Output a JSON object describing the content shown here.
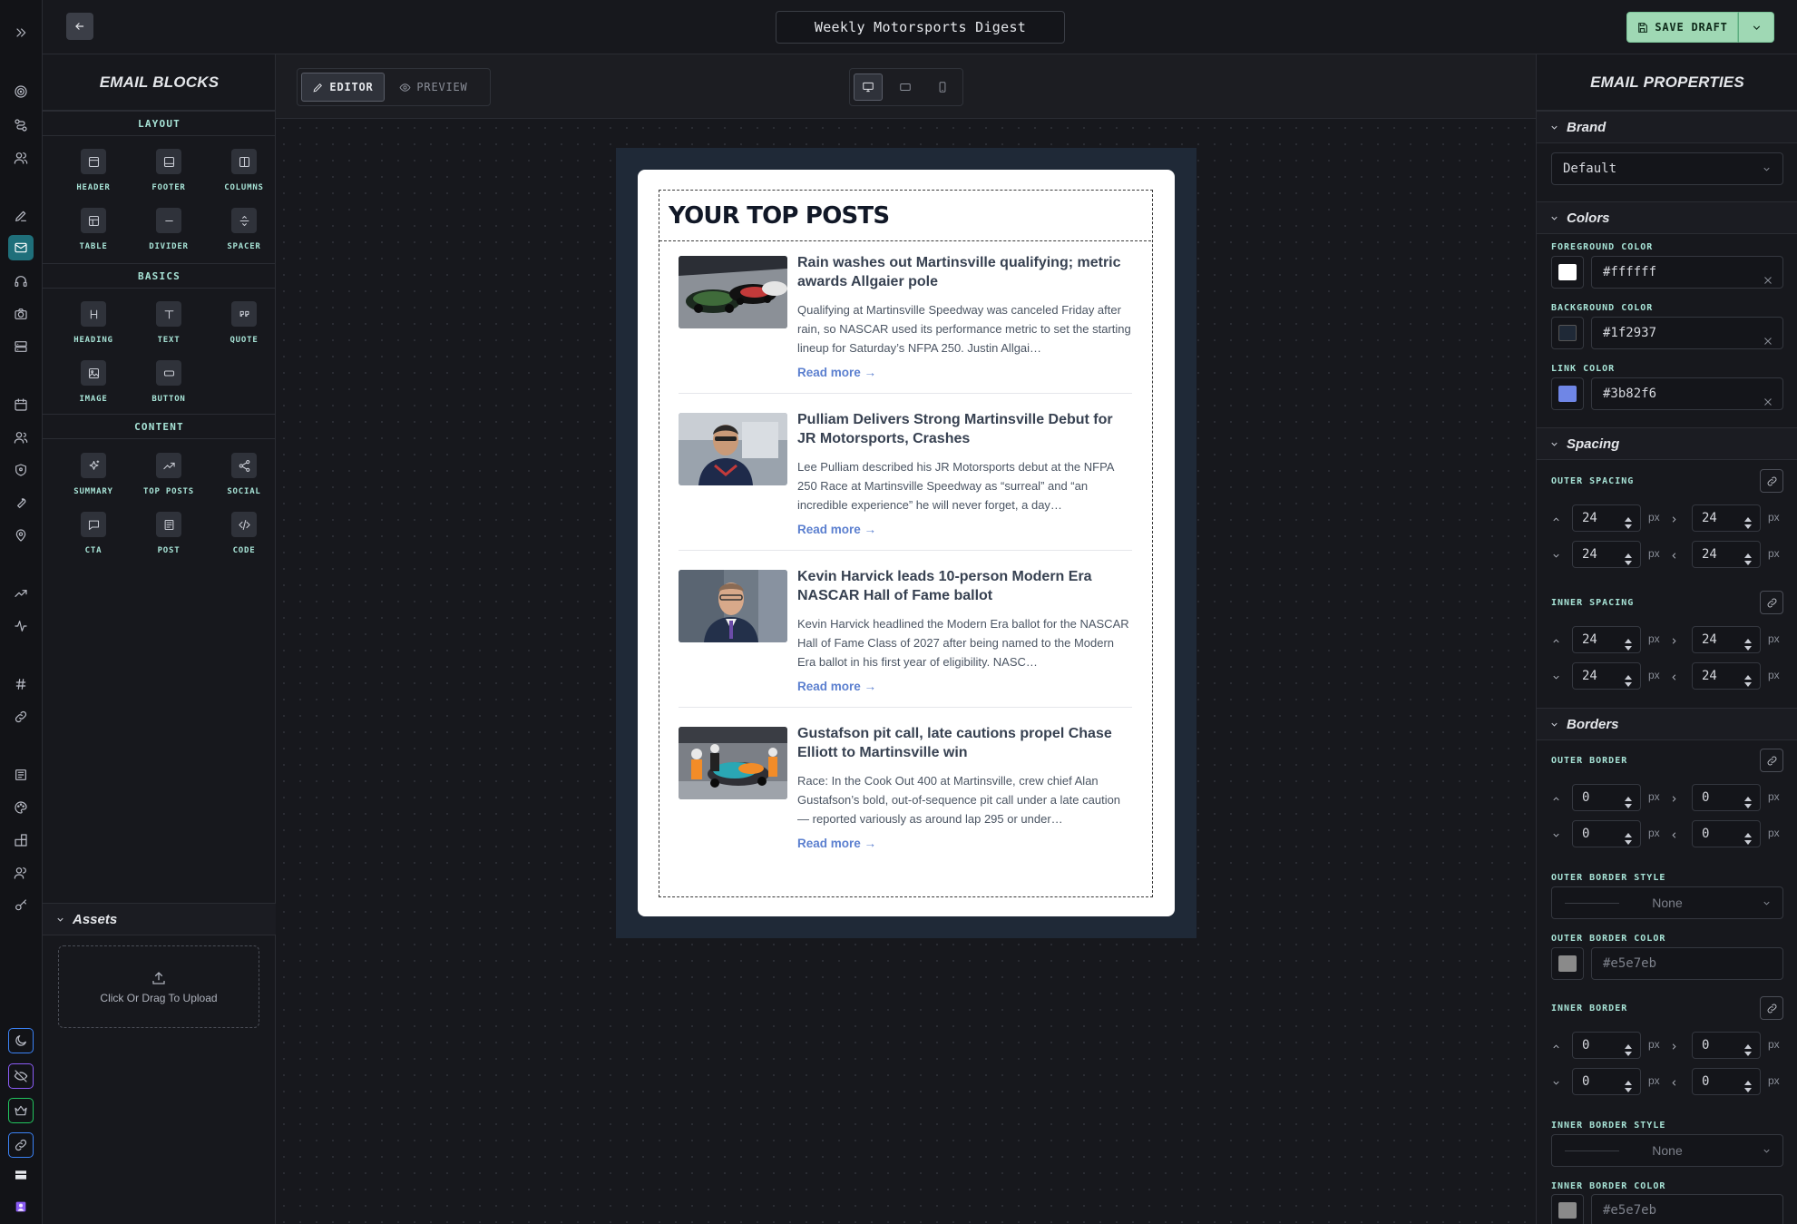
{
  "app": {
    "document_title": "Weekly Motorsports Digest",
    "save_label": "SAVE DRAFT"
  },
  "rail": {
    "icons": [
      "chevrons-right-icon",
      "target-icon",
      "route-icon",
      "users-icon",
      "pen-icon",
      "mail-icon",
      "headset-icon",
      "camera-icon",
      "server-icon",
      "calendar-icon",
      "people-icon",
      "shield-icon",
      "wrench-icon",
      "map-pin-icon",
      "trending-up-icon",
      "activity-icon",
      "hash-icon",
      "link-icon",
      "newspaper-icon",
      "palette-icon",
      "blocks-icon",
      "team-icon",
      "key-icon",
      "moon-icon",
      "eye-off-icon",
      "crown-icon",
      "chain-icon",
      "flag-icon",
      "avatar-icon"
    ]
  },
  "blocks_panel": {
    "title": "EMAIL BLOCKS",
    "sections": {
      "layout": "LAYOUT",
      "basics": "BASICS",
      "content": "CONTENT"
    },
    "layout_items": [
      "HEADER",
      "FOOTER",
      "COLUMNS",
      "TABLE",
      "DIVIDER",
      "SPACER"
    ],
    "basics_items": [
      "HEADING",
      "TEXT",
      "QUOTE",
      "IMAGE",
      "BUTTON"
    ],
    "content_items": [
      "SUMMARY",
      "TOP POSTS",
      "SOCIAL",
      "CTA",
      "POST",
      "CODE"
    ],
    "assets_title": "Assets",
    "upload_text": "Click Or Drag To Upload"
  },
  "canvas": {
    "mode_editor": "EDITOR",
    "mode_preview": "PREVIEW",
    "active_device": "desktop"
  },
  "email": {
    "header": "YOUR TOP POSTS",
    "read_more": "Read more →",
    "posts": [
      {
        "title": "Rain washes out Martinsville qualifying; metric awards Allgaier pole",
        "description": "Qualifying at Martinsville Speedway was canceled Friday after rain, so NASCAR used its performance metric to set the starting lineup for Saturday’s NFPA 250. Justin Allgai…"
      },
      {
        "title": "Pulliam Delivers Strong Martinsville Debut for JR Motorsports, Crashes",
        "description": "Lee Pulliam described his JR Motorsports debut at the NFPA 250 Race at Martinsville Speedway as “surreal” and “an incredible experience” he will never forget, a day…"
      },
      {
        "title": "Kevin Harvick leads 10-person Modern Era NASCAR Hall of Fame ballot",
        "description": "Kevin Harvick headlined the Modern Era ballot for the NASCAR Hall of Fame Class of 2027 after being named to the Modern Era ballot in his first year of eligibility. NASC…"
      },
      {
        "title": "Gustafson pit call, late cautions propel Chase Elliott to Martinsville win",
        "description": "Race: In the Cook Out 400 at Martinsville, crew chief Alan Gustafson’s bold, out-of-sequence pit call under a late caution — reported variously as around lap 295 or under…"
      }
    ]
  },
  "props_panel": {
    "title": "EMAIL PROPERTIES",
    "brand": {
      "heading": "Brand",
      "value": "Default"
    },
    "colors": {
      "heading": "Colors",
      "foreground_label": "FOREGROUND COLOR",
      "foreground_value": "#ffffff",
      "background_label": "BACKGROUND COLOR",
      "background_value": "#1f2937",
      "link_label": "LINK COLOR",
      "link_value": "#3b82f6"
    },
    "spacing": {
      "heading": "Spacing",
      "outer_label": "OUTER SPACING",
      "outer": [
        "24",
        "24",
        "24",
        "24"
      ],
      "inner_label": "INNER SPACING",
      "inner": [
        "24",
        "24",
        "24",
        "24"
      ]
    },
    "borders": {
      "heading": "Borders",
      "outer_label": "OUTER BORDER",
      "outer": [
        "0",
        "0",
        "0",
        "0"
      ],
      "outer_style_label": "OUTER BORDER STYLE",
      "outer_style": "None",
      "outer_color_label": "OUTER BORDER COLOR",
      "outer_color": "#e5e7eb",
      "inner_label": "INNER BORDER",
      "inner": [
        "0",
        "0",
        "0",
        "0"
      ],
      "inner_style_label": "INNER BORDER STYLE",
      "inner_style": "None",
      "inner_color_label": "INNER BORDER COLOR",
      "inner_color": "#e5e7eb"
    },
    "unit": "px"
  }
}
